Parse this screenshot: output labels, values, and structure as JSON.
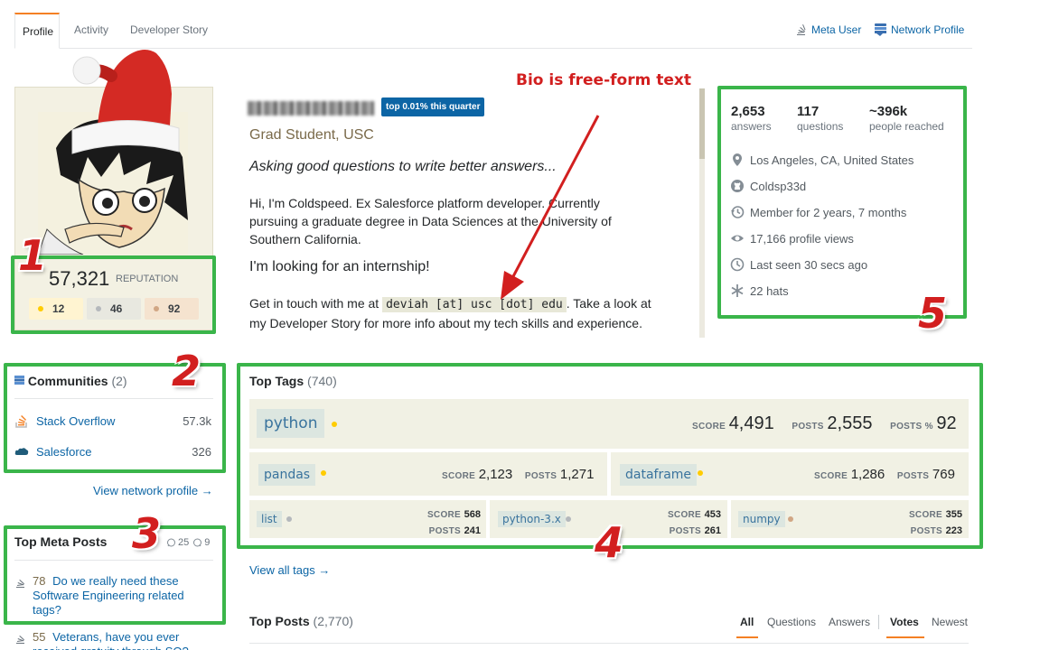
{
  "tabs": [
    {
      "label": "Profile"
    },
    {
      "label": "Activity"
    },
    {
      "label": "Developer Story"
    }
  ],
  "header_links": {
    "meta_user": "Meta User",
    "network_profile": "Network Profile"
  },
  "reputation": {
    "value": "57,321",
    "label": "REPUTATION"
  },
  "badges": {
    "gold": "12",
    "silver": "46",
    "bronze": "92"
  },
  "profile": {
    "top_badge": "top 0.01% this quarter",
    "title": "Grad Student, USC",
    "bio_heading": "Asking good questions to write better answers...",
    "bio_p1": "Hi, I'm Coldspeed. Ex Salesforce platform developer. Currently pursuing a graduate degree in Data Sciences at the University of Southern California.",
    "bio_internship": "I'm looking for an internship!",
    "bio_contact_pre": "Get in touch with me at",
    "bio_contact_email": "deviah [at] usc [dot] edu",
    "bio_contact_post": ". Take a look at my Developer Story for more info about my tech skills and experience."
  },
  "annotation": {
    "bio_note": "Bio is free-form text",
    "n1": "1",
    "n2": "2",
    "n3": "3",
    "n4": "4",
    "n5": "5"
  },
  "stats": {
    "answers": {
      "value": "2,653",
      "label": "answers"
    },
    "questions": {
      "value": "117",
      "label": "questions"
    },
    "reached": {
      "value": "~396k",
      "label": "people reached"
    }
  },
  "info": {
    "location": "Los Angeles, CA, United States",
    "github": "Coldsp33d",
    "member": "Member for 2 years, 7 months",
    "views": "17,166 profile views",
    "seen": "Last seen 30 secs ago",
    "hats": "22 hats"
  },
  "communities": {
    "title": "Communities",
    "count": "(2)",
    "items": [
      {
        "name": "Stack Overflow",
        "rep": "57.3k"
      },
      {
        "name": "Salesforce",
        "rep": "326"
      }
    ],
    "view_link": "View network profile →"
  },
  "meta_posts": {
    "title": "Top Meta Posts",
    "comments": "25",
    "answers": "9",
    "items": [
      {
        "score": "78",
        "title": "Do we really need these Software Engineering related tags?"
      },
      {
        "score": "55",
        "title": "Veterans, have you ever received gratuity through SO?"
      }
    ]
  },
  "top_tags": {
    "title": "Top Tags",
    "count": "(740)",
    "score_label": "SCORE",
    "posts_label": "POSTS",
    "posts_pct_label": "POSTS %",
    "primary": {
      "name": "python",
      "score": "4,491",
      "posts": "2,555",
      "posts_pct": "92"
    },
    "secondary": [
      {
        "name": "pandas",
        "score": "2,123",
        "posts": "1,271"
      },
      {
        "name": "dataframe",
        "score": "1,286",
        "posts": "769"
      }
    ],
    "tertiary": [
      {
        "name": "list",
        "score": "568",
        "posts": "241"
      },
      {
        "name": "python-3.x",
        "score": "453",
        "posts": "261"
      },
      {
        "name": "numpy",
        "score": "355",
        "posts": "223"
      }
    ],
    "view_all": "View all tags →"
  },
  "top_posts": {
    "title": "Top Posts",
    "count": "(2,770)",
    "filters": [
      "All",
      "Questions",
      "Answers",
      "Votes",
      "Newest"
    ]
  },
  "colors": {
    "accent": "#F48024",
    "link": "#0C65A5",
    "annotation_green": "#3AB54A",
    "annotation_red": "#D21F1F"
  }
}
